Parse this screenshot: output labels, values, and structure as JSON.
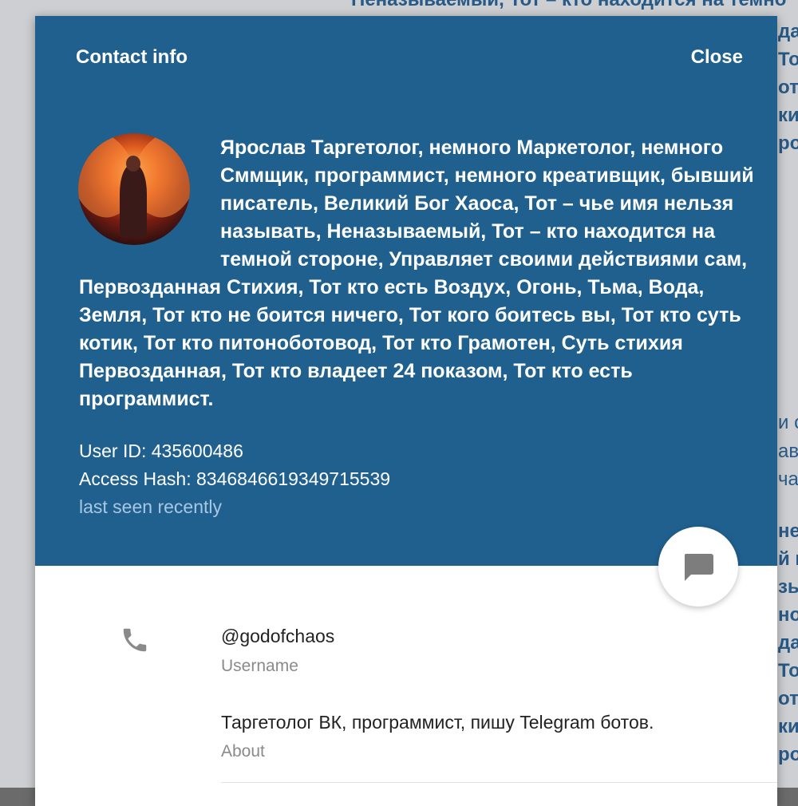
{
  "background_chat": {
    "lines": [
      "Неназываемый, Тот – кто находится на темно",
      "да",
      "Тот",
      "от",
      "ки",
      "ро",
      "и с",
      "ави",
      "ча",
      "не",
      "й и",
      "зы",
      "но",
      "да",
      "Тот",
      "от",
      "ки",
      "ро"
    ]
  },
  "modal": {
    "title": "Contact info",
    "close_label": "Close",
    "bio": "Ярослав Таргетолог, немного Маркетолог, немного Сммщик, программист, немного креативщик, бывший писатель, Великий Бог Хаоса, Тот – чье имя нельзя называть, Неназываемый, Тот – кто находится на темной стороне, Управляет своими действиями сам, Первозданная Стихия, Тот кто есть Воздух, Огонь, Тьма, Вода, Земля, Тот кто не боится ничего, Тот кого боитесь вы, Тот кто суть котик, Тот кто питоноботовод, Тот кто Грамотен, Суть стихия Первозданная, Тот кто владеет 24 показом, Тот кто есть программист.",
    "user_id": "User ID: 435600486",
    "access_hash": "Access Hash: 8346846619349715539",
    "last_seen": "last seen recently",
    "username_value": "@godofchaos",
    "username_label": "Username",
    "about_value": "Таргетолог ВК, программист, пишу Telegram ботов.",
    "about_label": "About"
  },
  "icons": {
    "phone": "phone-icon",
    "chat": "message-icon"
  },
  "colors": {
    "header_bg": "#20608f",
    "last_seen": "#a7c7e3",
    "label_gray": "#8a8a8a"
  }
}
